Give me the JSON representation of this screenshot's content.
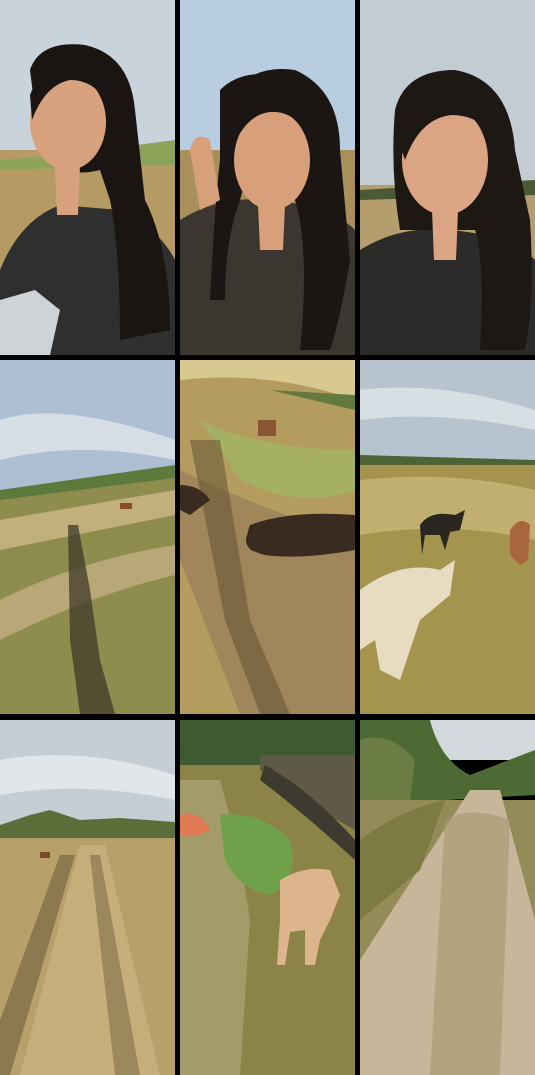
{
  "grid": {
    "rows": 3,
    "cols": 3,
    "divider_color": "#000000"
  },
  "panels": [
    {
      "id": "selfie-1",
      "subject": "selfie",
      "palette": {
        "sky": "#c9d3dc",
        "field": "#b59b63",
        "shirt": "#2f2f2f",
        "skin": "#d9a27e",
        "hair": "#1a1512"
      }
    },
    {
      "id": "selfie-2",
      "subject": "selfie",
      "palette": {
        "sky": "#b9cde0",
        "field": "#a98f5a",
        "shirt": "#3b3630",
        "skin": "#d79f7a",
        "hair": "#1b1614"
      }
    },
    {
      "id": "selfie-3",
      "subject": "selfie",
      "palette": {
        "sky": "#c4ccd3",
        "field": "#b59e6e",
        "shirt": "#2c2b29",
        "skin": "#dba584",
        "hair": "#1d1814"
      }
    },
    {
      "id": "field-shadow",
      "subject": "landscape",
      "palette": {
        "sky": "#aebfd3",
        "field": "#8f8d4e",
        "path": "#b8a777"
      }
    },
    {
      "id": "dogs-path",
      "subject": "animals",
      "palette": {
        "field": "#b39c5d",
        "path": "#a0865a",
        "dog": "#3a2b20"
      }
    },
    {
      "id": "goats-field",
      "subject": "animals",
      "palette": {
        "sky": "#b7c3cf",
        "field": "#a4944d",
        "goat_white": "#e7dcc1",
        "goat_dark": "#2c2620",
        "goat_brown": "#a8663f"
      }
    },
    {
      "id": "dirt-road-1",
      "subject": "landscape",
      "palette": {
        "sky": "#c5cdd5",
        "field": "#b7a06a",
        "path": "#c7ad7a",
        "trees": "#5a6f3a"
      }
    },
    {
      "id": "feeding-goat",
      "subject": "animals",
      "palette": {
        "field": "#8c8346",
        "greens": "#6ea14a",
        "goat": "#dcb58d",
        "trees": "#3e5a30"
      }
    },
    {
      "id": "dirt-road-2",
      "subject": "landscape",
      "palette": {
        "sky": "#d3d8dd",
        "field": "#948b58",
        "path": "#c8b69a",
        "trees": "#4d6a35"
      }
    }
  ]
}
